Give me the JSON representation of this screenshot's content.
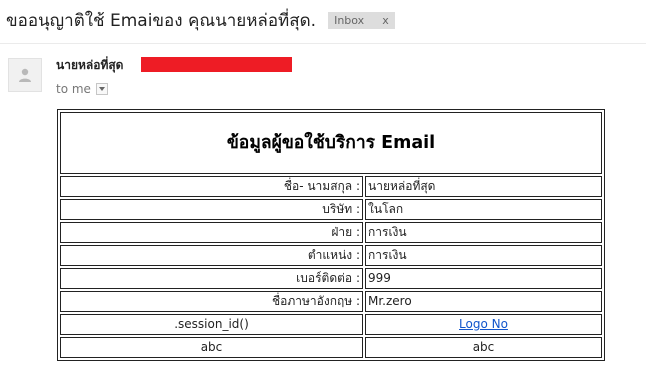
{
  "email": {
    "subject": "ขออนุญาติใช้ Emaiของ คุณนายหล่อที่สุด.",
    "label": "Inbox",
    "label_remove": "x",
    "sender_name": "นายหล่อที่สุด",
    "recipient": "to me"
  },
  "form": {
    "title": "ข้อมูลผู้ขอใช้บริการ Email",
    "rows": [
      {
        "label": "ชื่อ- นามสกุล :",
        "value": "นายหล่อที่สุด"
      },
      {
        "label": "บริษัท :",
        "value": "ในโลก"
      },
      {
        "label": "ฝ่าย :",
        "value": "การเงิน"
      },
      {
        "label": "ตำแหน่ง :",
        "value": "การเงิน"
      },
      {
        "label": "เบอร์ติดต่อ :",
        "value": "999"
      },
      {
        "label": "ชื่อภาษาอังกฤษ :",
        "value": "Mr.zero"
      }
    ],
    "session_text": ".session_id()",
    "logo_link": "Logo No",
    "footer_left": "abc",
    "footer_right": "abc"
  },
  "colors": {
    "redaction": "#ee1c25",
    "link": "#1155cc",
    "label_bg": "#dddddd"
  },
  "icons": {
    "avatar": "person-icon",
    "recipient_menu": "chevron-down-icon"
  }
}
